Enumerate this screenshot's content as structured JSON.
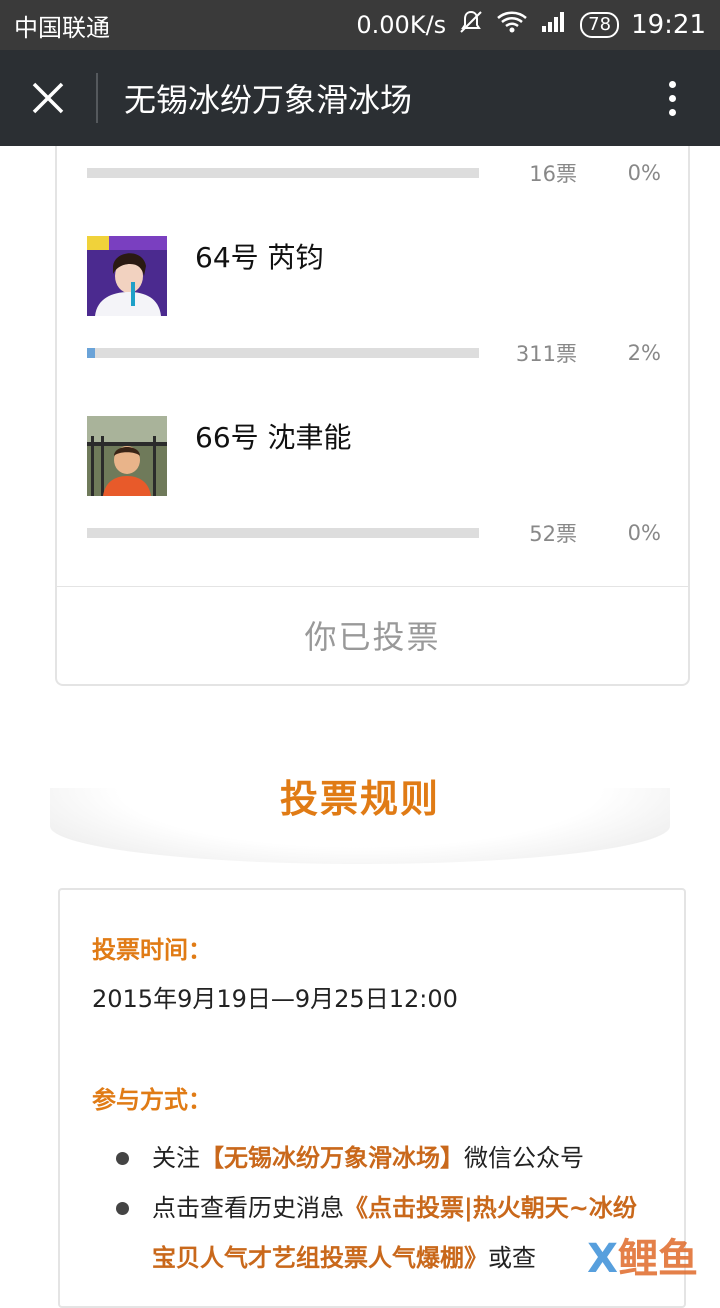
{
  "status_bar": {
    "carrier": "中国联通",
    "speed": "0.00K/s",
    "battery": "78",
    "time": "19:21"
  },
  "title_bar": {
    "title": "无锡冰纷万象滑冰场"
  },
  "vote_list": {
    "top_row": {
      "votes": "16票",
      "percent": "0%",
      "fill_fraction": 0.0
    },
    "candidates": [
      {
        "name": "64号 芮钧",
        "votes": "311票",
        "percent": "2%",
        "fill_fraction": 0.02
      },
      {
        "name": "66号 沈聿能",
        "votes": "52票",
        "percent": "0%",
        "fill_fraction": 0.0
      }
    ],
    "voted_label": "你已投票"
  },
  "rules": {
    "heading": "投票规则",
    "time_title": "投票时间：",
    "time_text": "2015年9月19日—9月25日12:00",
    "method_title": "参与方式：",
    "item1_pre": "关注",
    "item1_hl": "【无锡冰纷万象滑冰场】",
    "item1_post": "微信公众号",
    "item2_pre": "点击查看历史消息",
    "item2_hl": "《点击投票|热火朝天~冰纷宝贝人气才艺组投票人气爆棚》",
    "item2_post": "或查"
  },
  "watermark": {
    "part1": "X",
    "part2": "鲤鱼"
  },
  "colors": {
    "accent": "#e07b15",
    "bar_fill": "#6aa3d8",
    "header_bg": "#2b2f33"
  }
}
